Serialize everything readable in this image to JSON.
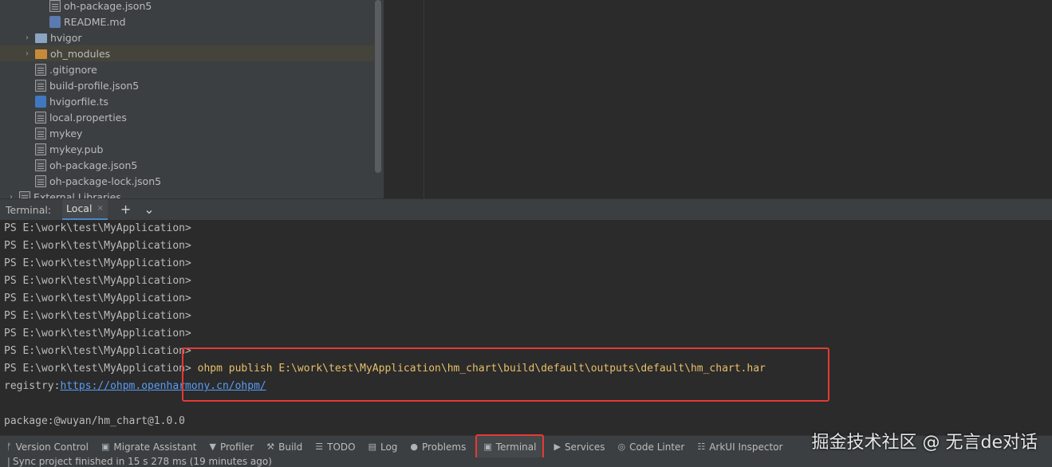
{
  "project_tree": {
    "items": [
      {
        "label": "oh-package.json5",
        "icon": "json-file-icon",
        "kind": "file"
      },
      {
        "label": "README.md",
        "icon": "markdown-file-icon",
        "kind": "md"
      },
      {
        "label": "hvigor",
        "icon": "folder-icon",
        "kind": "folder"
      },
      {
        "label": "oh_modules",
        "icon": "folder-icon",
        "kind": "folder-orange"
      },
      {
        "label": ".gitignore",
        "icon": "file-icon",
        "kind": "file"
      },
      {
        "label": "build-profile.json5",
        "icon": "json-file-icon",
        "kind": "file"
      },
      {
        "label": "hvigorfile.ts",
        "icon": "typescript-file-icon",
        "kind": "ts"
      },
      {
        "label": "local.properties",
        "icon": "properties-file-icon",
        "kind": "file"
      },
      {
        "label": "mykey",
        "icon": "file-icon",
        "kind": "file"
      },
      {
        "label": "mykey.pub",
        "icon": "file-icon",
        "kind": "file"
      },
      {
        "label": "oh-package.json5",
        "icon": "json-file-icon",
        "kind": "file"
      },
      {
        "label": "oh-package-lock.json5",
        "icon": "json-file-icon",
        "kind": "file"
      },
      {
        "label": "External Libraries",
        "icon": "library-icon",
        "kind": "file"
      }
    ]
  },
  "terminal": {
    "title": "Terminal:",
    "tab_label": "Local",
    "tab_close": "×",
    "add_label": "+",
    "more_label": "⌄",
    "prompt": "PS E:\\work\\test\\MyApplication>",
    "command": "ohpm publish E:\\work\\test\\MyApplication\\hm_chart\\build\\default\\outputs\\default\\hm_chart.har",
    "registry_label": "registry:",
    "registry_url": "https://ohpm.openharmony.cn/ohpm/",
    "package_line": "package:@wuyan/hm_chart@1.0.0"
  },
  "toolwindows": [
    {
      "label": "Version Control",
      "icon": "version-control-icon",
      "glyph": "ᚠ"
    },
    {
      "label": "Migrate Assistant",
      "icon": "migrate-icon",
      "glyph": "▣"
    },
    {
      "label": "Profiler",
      "icon": "profiler-icon",
      "glyph": "▼"
    },
    {
      "label": "Build",
      "icon": "build-icon",
      "glyph": "⚒"
    },
    {
      "label": "TODO",
      "icon": "todo-icon",
      "glyph": "☰"
    },
    {
      "label": "Log",
      "icon": "log-icon",
      "glyph": "▤"
    },
    {
      "label": "Problems",
      "icon": "problems-icon",
      "glyph": "●"
    },
    {
      "label": "Terminal",
      "icon": "terminal-icon",
      "glyph": "▣"
    },
    {
      "label": "Services",
      "icon": "services-icon",
      "glyph": "▶"
    },
    {
      "label": "Code Linter",
      "icon": "code-linter-icon",
      "glyph": "◎"
    },
    {
      "label": "ArkUI Inspector",
      "icon": "arkui-inspector-icon",
      "glyph": "☷"
    }
  ],
  "watermark": "掘金技术社区 @ 无言de对话",
  "status": {
    "text": "Sync project finished in 15 s 278 ms (19 minutes ago)"
  },
  "colors": {
    "highlight": "#e53935",
    "link": "#589df6",
    "command": "#e8bf6a"
  }
}
